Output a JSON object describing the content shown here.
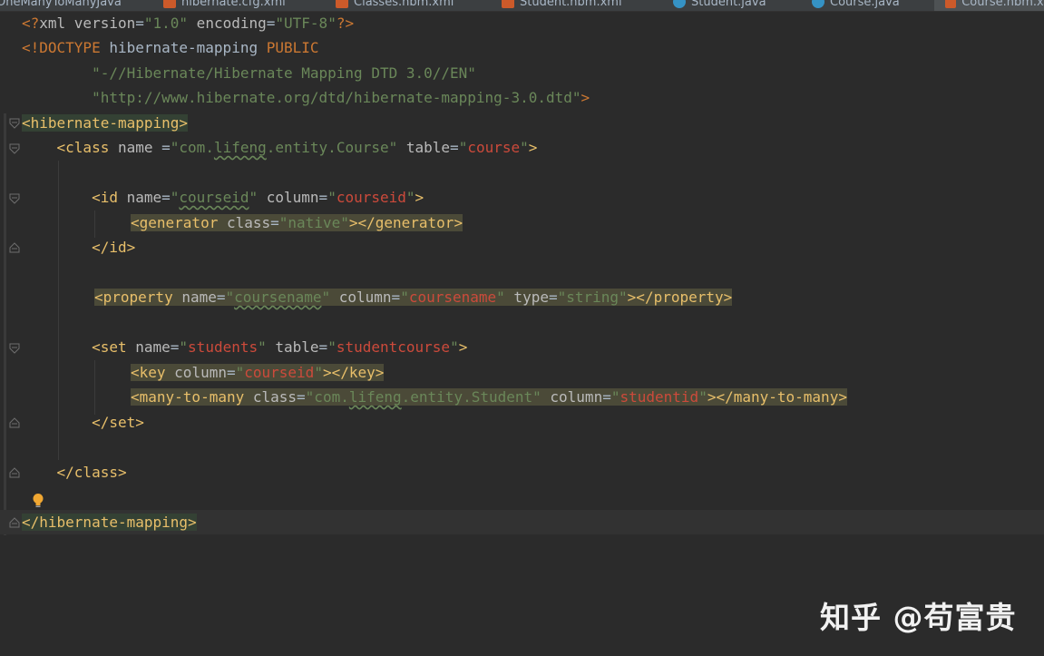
{
  "tabs": [
    {
      "label": "OneManyToManyJava",
      "icon": "java-class-icon"
    },
    {
      "label": "hibernate.cfg.xml",
      "icon": "xml-file-icon"
    },
    {
      "label": "Classes.hbm.xml",
      "icon": "xml-file-icon"
    },
    {
      "label": "Student.hbm.xml",
      "icon": "xml-file-icon"
    },
    {
      "label": "Student.java",
      "icon": "java-class-icon"
    },
    {
      "label": "Course.java",
      "icon": "java-class-icon"
    },
    {
      "label": "Course.hbm.xml",
      "icon": "xml-file-icon"
    }
  ],
  "code": {
    "l1": {
      "a": "<?",
      "b": "xml version",
      "c": "=",
      "d": "\"1.0\"",
      "e": " encoding",
      "f": "=",
      "g": "\"UTF-8\"",
      "h": "?>"
    },
    "l2": {
      "a": "<!DOCTYPE ",
      "b": "hibernate-mapping ",
      "c": "PUBLIC"
    },
    "l3": {
      "a": "        \"-//Hibernate/Hibernate Mapping DTD 3.0//EN\""
    },
    "l4": {
      "a": "        \"http://www.hibernate.org/dtd/hibernate-mapping-3.0.dtd\"",
      "b": ">"
    },
    "l5": {
      "a": "<hibernate-mapping>"
    },
    "l6": {
      "a": "    <class ",
      "b": "name ",
      "c": "=",
      "d": "\"com.",
      "e": "lifeng",
      "f": ".entity.Course\"",
      "g": " table",
      "h": "=",
      "i": "\"",
      "j": "course",
      "k": "\"",
      "l": ">"
    },
    "l8": {
      "a": "        <id ",
      "b": "name",
      "c": "=",
      "d": "\"",
      "e": "courseid",
      "f": "\"",
      "g": " column",
      "h": "=",
      "i": "\"",
      "j": "courseid",
      "k": "\"",
      "l": ">"
    },
    "l9": {
      "a": "<generator ",
      "b": "class",
      "c": "=",
      "d": "\"native\"",
      "e": "></generator>"
    },
    "l10": {
      "a": "        </id>"
    },
    "l12": {
      "a": "<property ",
      "b": "name",
      "c": "=",
      "d": "\"",
      "e": "coursename",
      "f": "\"",
      "g": " column",
      "h": "=",
      "i": "\"",
      "j": "coursename",
      "k": "\"",
      "l": " type",
      "m": "=",
      "n": "\"string\"",
      "o": "></property>"
    },
    "l14": {
      "a": "        <set ",
      "b": "name",
      "c": "=",
      "d": "\"",
      "e": "students",
      "f": "\"",
      "g": " table",
      "h": "=",
      "i": "\"",
      "j": "studentcourse",
      "k": "\"",
      "l": ">"
    },
    "l15": {
      "a": "<key ",
      "b": "column",
      "c": "=",
      "d": "\"",
      "e": "courseid",
      "f": "\"",
      "g": "></key>"
    },
    "l16": {
      "a": "<many-to-many ",
      "b": "class",
      "c": "=",
      "d": "\"com.",
      "e": "lifeng",
      "f": ".entity.Student\"",
      "g": " column",
      "h": "=",
      "i": "\"",
      "j": "studentid",
      "k": "\"",
      "l": "></many-to-many>"
    },
    "l17": {
      "a": "        </set>"
    },
    "l19": {
      "a": "    </class>"
    },
    "l21": {
      "a": "</hibernate-mapping>"
    }
  },
  "watermark": "知乎 @苟富贵"
}
